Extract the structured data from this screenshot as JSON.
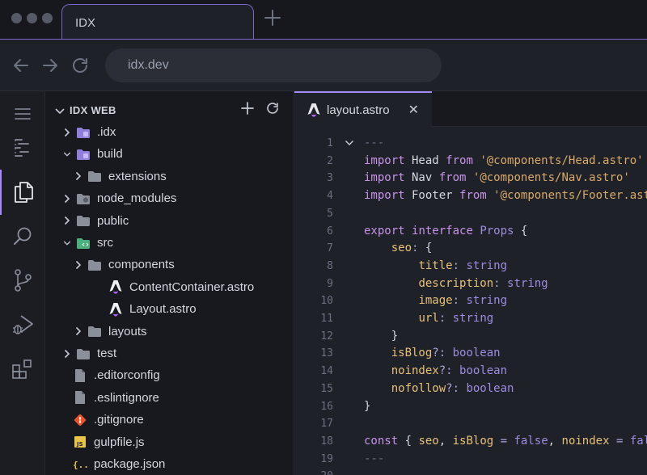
{
  "browser": {
    "tab_title": "IDX",
    "url": "idx.dev"
  },
  "explorer": {
    "title": "IDX WEB",
    "items": [
      {
        "label": ".idx",
        "depth": 0,
        "kind": "folder-special",
        "expanded": false
      },
      {
        "label": "build",
        "depth": 0,
        "kind": "folder-special",
        "expanded": true
      },
      {
        "label": "extensions",
        "depth": 1,
        "kind": "folder",
        "expanded": false
      },
      {
        "label": "node_modules",
        "depth": 0,
        "kind": "folder-node",
        "expanded": false
      },
      {
        "label": "public",
        "depth": 0,
        "kind": "folder",
        "expanded": false
      },
      {
        "label": "src",
        "depth": 0,
        "kind": "folder-src",
        "expanded": true
      },
      {
        "label": "components",
        "depth": 1,
        "kind": "folder",
        "expanded": false
      },
      {
        "label": "ContentContainer.astro",
        "depth": 2,
        "kind": "astro"
      },
      {
        "label": "Layout.astro",
        "depth": 2,
        "kind": "astro"
      },
      {
        "label": "layouts",
        "depth": 1,
        "kind": "folder",
        "expanded": false
      },
      {
        "label": "test",
        "depth": 0,
        "kind": "folder",
        "expanded": false
      },
      {
        "label": ".editorconfig",
        "depth": 0,
        "kind": "file"
      },
      {
        "label": ".eslintignore",
        "depth": 0,
        "kind": "file"
      },
      {
        "label": ".gitignore",
        "depth": 0,
        "kind": "git"
      },
      {
        "label": "gulpfile.js",
        "depth": 0,
        "kind": "js"
      },
      {
        "label": "package.json",
        "depth": 0,
        "kind": "json"
      }
    ]
  },
  "editor": {
    "tab_label": "layout.astro",
    "lines": [
      {
        "n": "1",
        "fold": true,
        "tokens": [
          [
            "cm",
            "---"
          ]
        ]
      },
      {
        "n": "2",
        "tokens": [
          [
            "kw",
            "import"
          ],
          [
            "pl",
            " Head "
          ],
          [
            "kw",
            "from"
          ],
          [
            "pl",
            " "
          ],
          [
            "st",
            "'@components/Head.astro'"
          ]
        ]
      },
      {
        "n": "3",
        "tokens": [
          [
            "kw",
            "import"
          ],
          [
            "pl",
            " Nav "
          ],
          [
            "kw",
            "from"
          ],
          [
            "pl",
            " "
          ],
          [
            "st",
            "'@components/Nav.astro'"
          ]
        ]
      },
      {
        "n": "4",
        "tokens": [
          [
            "kw",
            "import"
          ],
          [
            "pl",
            " Footer "
          ],
          [
            "kw",
            "from"
          ],
          [
            "pl",
            " "
          ],
          [
            "st",
            "'@components/Footer.astro'"
          ]
        ]
      },
      {
        "n": "5",
        "tokens": []
      },
      {
        "n": "6",
        "tokens": [
          [
            "kw",
            "export"
          ],
          [
            "pl",
            " "
          ],
          [
            "kw",
            "interface"
          ],
          [
            "pl",
            " "
          ],
          [
            "ty",
            "Props"
          ],
          [
            "pl",
            " {"
          ]
        ]
      },
      {
        "n": "7",
        "tokens": [
          [
            "pl",
            "    "
          ],
          [
            "pr",
            "seo"
          ],
          [
            "op",
            ":"
          ],
          [
            "pl",
            " {"
          ]
        ]
      },
      {
        "n": "8",
        "tokens": [
          [
            "pl",
            "        "
          ],
          [
            "pr",
            "title"
          ],
          [
            "op",
            ":"
          ],
          [
            "pl",
            " "
          ],
          [
            "ty",
            "string"
          ]
        ]
      },
      {
        "n": "9",
        "tokens": [
          [
            "pl",
            "        "
          ],
          [
            "pr",
            "description"
          ],
          [
            "op",
            ":"
          ],
          [
            "pl",
            " "
          ],
          [
            "ty",
            "string"
          ]
        ]
      },
      {
        "n": "10",
        "tokens": [
          [
            "pl",
            "        "
          ],
          [
            "pr",
            "image"
          ],
          [
            "op",
            ":"
          ],
          [
            "pl",
            " "
          ],
          [
            "ty",
            "string"
          ]
        ]
      },
      {
        "n": "11",
        "tokens": [
          [
            "pl",
            "        "
          ],
          [
            "pr",
            "url"
          ],
          [
            "op",
            ":"
          ],
          [
            "pl",
            " "
          ],
          [
            "ty",
            "string"
          ]
        ]
      },
      {
        "n": "12",
        "tokens": [
          [
            "pl",
            "    }"
          ]
        ]
      },
      {
        "n": "13",
        "tokens": [
          [
            "pl",
            "    "
          ],
          [
            "pr",
            "isBlog"
          ],
          [
            "op",
            "?:"
          ],
          [
            "pl",
            " "
          ],
          [
            "ty",
            "boolean"
          ]
        ]
      },
      {
        "n": "14",
        "tokens": [
          [
            "pl",
            "    "
          ],
          [
            "pr",
            "noindex"
          ],
          [
            "op",
            "?:"
          ],
          [
            "pl",
            " "
          ],
          [
            "ty",
            "boolean"
          ]
        ]
      },
      {
        "n": "15",
        "tokens": [
          [
            "pl",
            "    "
          ],
          [
            "pr",
            "nofollow"
          ],
          [
            "op",
            "?:"
          ],
          [
            "pl",
            " "
          ],
          [
            "ty",
            "boolean"
          ]
        ]
      },
      {
        "n": "16",
        "tokens": [
          [
            "pl",
            "}"
          ]
        ]
      },
      {
        "n": "17",
        "tokens": []
      },
      {
        "n": "18",
        "tokens": [
          [
            "kw",
            "const"
          ],
          [
            "pl",
            " { "
          ],
          [
            "pr",
            "seo"
          ],
          [
            "pl",
            ", "
          ],
          [
            "pr",
            "isBlog"
          ],
          [
            "pl",
            " "
          ],
          [
            "op",
            "="
          ],
          [
            "pl",
            " "
          ],
          [
            "ty",
            "false"
          ],
          [
            "pl",
            ", "
          ],
          [
            "pr",
            "noindex"
          ],
          [
            "pl",
            " "
          ],
          [
            "op",
            "="
          ],
          [
            "pl",
            " "
          ],
          [
            "ty",
            "false"
          ]
        ]
      },
      {
        "n": "19",
        "tokens": [
          [
            "cm",
            "---"
          ]
        ]
      },
      {
        "n": "20",
        "tokens": []
      }
    ]
  },
  "colors": {
    "accent": "#a58bf5",
    "tab_border": "#7b67c9"
  }
}
